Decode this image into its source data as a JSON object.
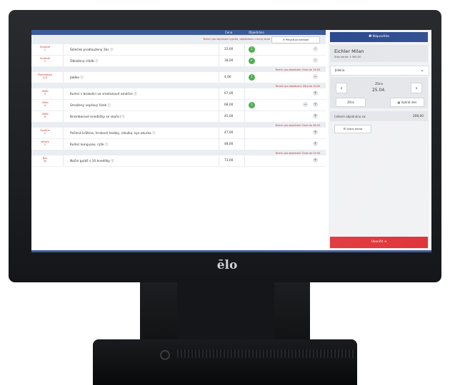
{
  "device": {
    "brand_logo": "ēlo"
  },
  "table": {
    "header": {
      "price": "Cena",
      "ordered": "Objednáno"
    },
    "sections": [
      {
        "deadline": "Termín pro objednání vypršel, objednávku z burzy zbral",
        "move_button": "Převzít od stránek",
        "rows": [
          {
            "category": "Snídaně",
            "num": "1",
            "name": "Šáleček prodloužený 2ks",
            "price": "22,00",
            "ordered": "1",
            "ctl": "ok"
          },
          {
            "category": "Snídaně",
            "num": "2",
            "name": "Obložený chléb",
            "price": "18,00",
            "ordered": "✔",
            "ctl": "ok"
          }
        ]
      },
      {
        "deadline": "Termín pro objednání: Dnes do 14:00",
        "rows": [
          {
            "category": "Přesnídávka",
            "num": "123",
            "name": "Jablko",
            "price": "4,00",
            "ordered": "1",
            "ctl": "minus"
          }
        ]
      },
      {
        "deadline": "Termín pro objednání: Zítra do 10:00",
        "rows": [
          {
            "category": "Oběd",
            "num": "3",
            "name": "Kuřecí s brokolicí ve smetanové omáčce",
            "price": "67,00",
            "ordered": "",
            "ctl": "plus"
          },
          {
            "category": "Oběd",
            "num": "4",
            "name": "Smažený vepřový řízek",
            "price": "68,00",
            "ordered": "1",
            "ctl": "minus-plus"
          },
          {
            "category": "Oběd",
            "num": "8",
            "name": "Bramborové knedlíčky se skořicí",
            "price": "45,00",
            "ordered": "",
            "ctl": "plus"
          }
        ]
      },
      {
        "deadline": "Termín pro objednání: Dnes do 08:00",
        "rows": [
          {
            "category": "Svačina",
            "num": "1",
            "name": "Pečená krůtina, hrnkové řezáky, cibulka, kys.okurka",
            "price": "47,00",
            "ordered": "",
            "ctl": "plus"
          },
          {
            "category": "Večeře",
            "num": "2",
            "name": "Kuřecí kung-pao, rýže",
            "price": "48,00",
            "ordered": "",
            "ctl": "plus"
          }
        ]
      },
      {
        "deadline": "Termín pro objednání: Dnes do 22:00",
        "rows": [
          {
            "category": "Noc",
            "num": "30",
            "name": "Noční guláš s 10 knedlíky",
            "price": "73,00",
            "ordered": "",
            "ctl": "plus"
          }
        ]
      }
    ]
  },
  "sidebar": {
    "help": "❶ Nápověda",
    "customer_name": "Eichler Milan",
    "credit": "Stav konta: 5 560,00",
    "select_value": "Jídelna",
    "day_label": "Zítra",
    "day_date": "25.04.",
    "btn_tomorrow": "Zítra",
    "btn_pick_day": "Vybrat den",
    "total_label": "Celkem objednáno za:",
    "total_value": "208,00",
    "history_button": "Výpis konta",
    "logout_button": "Ukončit ➔"
  },
  "colors": {
    "header_blue": "#3d5a99",
    "help_blue": "#2c4a8f",
    "badge_green": "#4caf50",
    "danger_red": "#e0353a",
    "deadline_red": "#c0392b"
  }
}
